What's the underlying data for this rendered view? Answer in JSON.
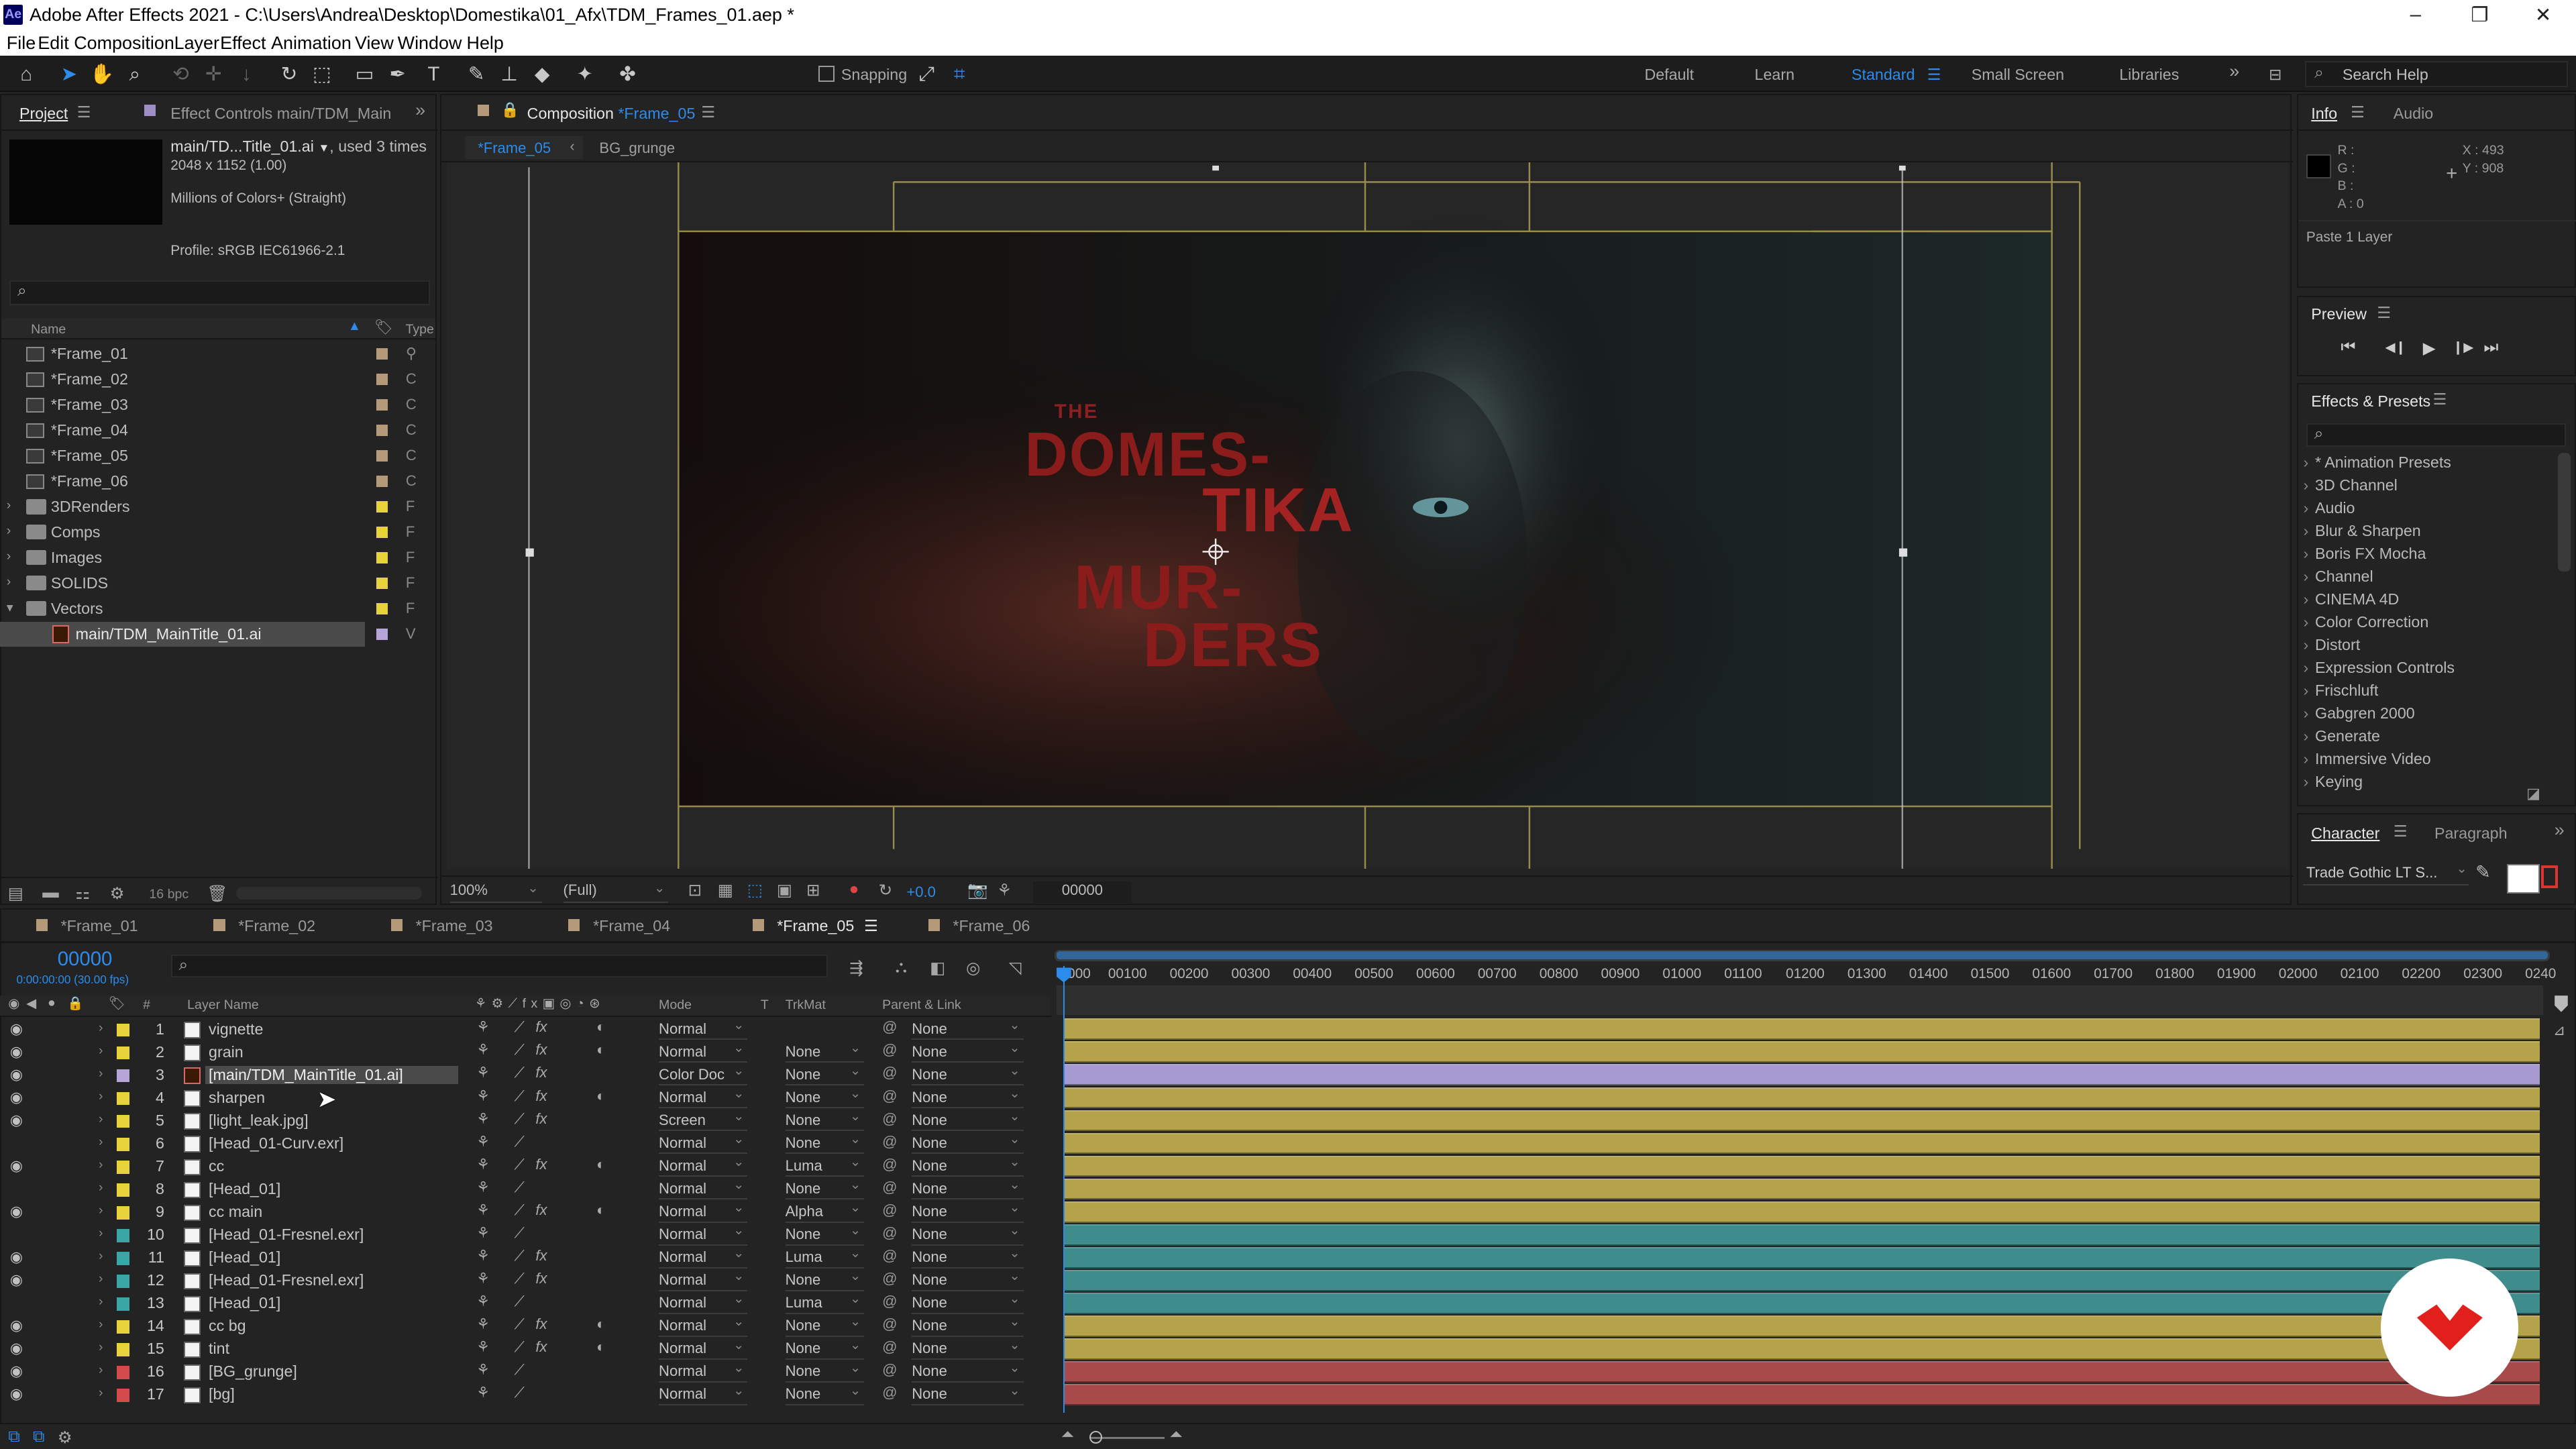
{
  "app": {
    "title": "Adobe After Effects 2021 - C:\\Users\\Andrea\\Desktop\\Domestika\\01_Afx\\TDM_Frames_01.aep *",
    "logo": "Ae",
    "window_controls": [
      "–",
      "❐",
      "✕"
    ]
  },
  "menu": [
    "File",
    "Edit",
    "Composition",
    "Layer",
    "Effect",
    "Animation",
    "View",
    "Window",
    "Help"
  ],
  "toolbar": {
    "snapping_label": "Snapping",
    "workspaces": [
      "Default",
      "Learn",
      "Standard",
      "Small Screen",
      "Libraries"
    ],
    "active_workspace": "Standard",
    "more": "»",
    "search_placeholder": "Search Help"
  },
  "project_panel": {
    "tab_project": "Project",
    "tab_effect_controls": "Effect Controls main/TDM_Main",
    "more": "»",
    "selected_name": "main/TD...Title_01.ai",
    "used_times": ", used 3 times",
    "dimensions": "2048 x 1152 (1.00)",
    "colors": "Millions of Colors+ (Straight)",
    "profile": "Profile: sRGB IEC61966-2.1",
    "search_icon": "⌕",
    "col_name": "Name",
    "col_type": "Type",
    "items": [
      {
        "name": "*Frame_01",
        "kind": "comp",
        "color": "#b59a7a",
        "type": "⚲"
      },
      {
        "name": "*Frame_02",
        "kind": "comp",
        "color": "#b59a7a",
        "type": "C"
      },
      {
        "name": "*Frame_03",
        "kind": "comp",
        "color": "#b59a7a",
        "type": "C"
      },
      {
        "name": "*Frame_04",
        "kind": "comp",
        "color": "#b59a7a",
        "type": "C"
      },
      {
        "name": "*Frame_05",
        "kind": "comp",
        "color": "#b59a7a",
        "type": "C"
      },
      {
        "name": "*Frame_06",
        "kind": "comp",
        "color": "#b59a7a",
        "type": "C"
      },
      {
        "name": "3DRenders",
        "kind": "folder",
        "color": "#e8d23a",
        "type": "F"
      },
      {
        "name": "Comps",
        "kind": "folder",
        "color": "#e8d23a",
        "type": "F"
      },
      {
        "name": "Images",
        "kind": "folder",
        "color": "#e8d23a",
        "type": "F"
      },
      {
        "name": "SOLIDS",
        "kind": "folder",
        "color": "#e8d23a",
        "type": "F"
      },
      {
        "name": "Vectors",
        "kind": "folder",
        "color": "#e8d23a",
        "type": "F"
      },
      {
        "name": "main/TDM_MainTitle_01.ai",
        "kind": "ai",
        "color": "#b6a5d8",
        "type": "V"
      }
    ],
    "bpc": "16 bpc"
  },
  "composition_panel": {
    "tab_label": "Composition",
    "tab_name": "*Frame_05",
    "sub_tab_active": "*Frame_05",
    "sub_tab_other": "BG_grunge",
    "title_lines": [
      "THE",
      "DOMES-",
      "TIKA",
      "MUR-",
      "DERS"
    ],
    "zoom": "100%",
    "resolution": "(Full)",
    "exposure": "+0.0",
    "timecode": "00000"
  },
  "info_panel": {
    "tab_info": "Info",
    "tab_audio": "Audio",
    "r": "R :",
    "g": "G :",
    "b": "B :",
    "a": "A : 0",
    "x": "X : 493",
    "y": "Y : 908",
    "message": "Paste 1 Layer"
  },
  "preview_panel": {
    "title": "Preview",
    "controls": [
      "⏮",
      "◀❙",
      "▶",
      "❙▶",
      "⏭"
    ]
  },
  "effects_panel": {
    "title": "Effects & Presets",
    "search_icon": "⌕",
    "categories": [
      "* Animation Presets",
      "3D Channel",
      "Audio",
      "Blur & Sharpen",
      "Boris FX Mocha",
      "Channel",
      "CINEMA 4D",
      "Color Correction",
      "Distort",
      "Expression Controls",
      "Frischluft",
      "Gabgren 2000",
      "Generate",
      "Immersive Video",
      "Keying"
    ]
  },
  "character_panel": {
    "tab_character": "Character",
    "tab_paragraph": "Paragraph",
    "font": "Trade Gothic LT S..."
  },
  "timeline": {
    "tabs": [
      {
        "name": "*Frame_01",
        "color": "#b59a7a"
      },
      {
        "name": "*Frame_02",
        "color": "#b59a7a"
      },
      {
        "name": "*Frame_03",
        "color": "#b59a7a"
      },
      {
        "name": "*Frame_04",
        "color": "#b59a7a"
      },
      {
        "name": "*Frame_05",
        "color": "#b59a7a"
      },
      {
        "name": "*Frame_06",
        "color": "#b59a7a"
      }
    ],
    "active_tab": "*Frame_05",
    "timecode": "00000",
    "fps": "0:00:00:00 (30.00 fps)",
    "search_icon": "⌕",
    "col_num": "#",
    "col_layer_name": "Layer Name",
    "col_mode": "Mode",
    "col_t": "T",
    "col_trkmat": "TrkMat",
    "col_parent": "Parent & Link",
    "ruler": [
      "0000",
      "00100",
      "00200",
      "00300",
      "00400",
      "00500",
      "00600",
      "00700",
      "00800",
      "00900",
      "01000",
      "01100",
      "01200",
      "01300",
      "01400",
      "01500",
      "01600",
      "01700",
      "01800",
      "01900",
      "02000",
      "02100",
      "02200",
      "02300",
      "0240"
    ],
    "layers": [
      {
        "num": "1",
        "name": "vignette",
        "label": "#e8d23a",
        "eye": true,
        "fx": true,
        "adj": true,
        "mode": "Normal",
        "trkmat": "",
        "parent": "None",
        "bar": "#b4a34a"
      },
      {
        "num": "2",
        "name": "grain",
        "label": "#e8d23a",
        "eye": true,
        "fx": true,
        "adj": true,
        "mode": "Normal",
        "trkmat": "None",
        "parent": "None",
        "bar": "#b4a34a"
      },
      {
        "num": "3",
        "name": "[main/TDM_MainTitle_01.ai]",
        "label": "#b6a5d8",
        "eye": true,
        "fx": true,
        "adj": false,
        "mode": "Color Doc",
        "trkmat": "None",
        "parent": "None",
        "bar": "#9c90c4",
        "selected": true
      },
      {
        "num": "4",
        "name": "sharpen",
        "label": "#e8d23a",
        "eye": true,
        "fx": true,
        "adj": true,
        "mode": "Normal",
        "trkmat": "None",
        "parent": "None",
        "bar": "#b4a34a"
      },
      {
        "num": "5",
        "name": "[light_leak.jpg]",
        "label": "#e8d23a",
        "eye": true,
        "fx": true,
        "adj": false,
        "mode": "Screen",
        "trkmat": "None",
        "parent": "None",
        "bar": "#b4a34a"
      },
      {
        "num": "6",
        "name": "[Head_01-Curv.exr]",
        "label": "#e8d23a",
        "eye": false,
        "fx": false,
        "adj": false,
        "mode": "Normal",
        "trkmat": "None",
        "parent": "None",
        "bar": "#b4a34a"
      },
      {
        "num": "7",
        "name": "cc",
        "label": "#e8d23a",
        "eye": true,
        "fx": true,
        "adj": true,
        "mode": "Normal",
        "trkmat": "Luma",
        "parent": "None",
        "bar": "#b4a34a"
      },
      {
        "num": "8",
        "name": "[Head_01]",
        "label": "#e8d23a",
        "eye": false,
        "fx": false,
        "adj": false,
        "mode": "Normal",
        "trkmat": "None",
        "parent": "None",
        "bar": "#b4a34a"
      },
      {
        "num": "9",
        "name": "cc main",
        "label": "#e8d23a",
        "eye": true,
        "fx": true,
        "adj": true,
        "mode": "Normal",
        "trkmat": "Alpha",
        "parent": "None",
        "bar": "#b4a34a"
      },
      {
        "num": "10",
        "name": "[Head_01-Fresnel.exr]",
        "label": "#3aa6a6",
        "eye": false,
        "fx": false,
        "adj": false,
        "mode": "Normal",
        "trkmat": "None",
        "parent": "None",
        "bar": "#3f8c8c"
      },
      {
        "num": "11",
        "name": "[Head_01]",
        "label": "#3aa6a6",
        "eye": true,
        "fx": true,
        "adj": false,
        "mode": "Normal",
        "trkmat": "Luma",
        "parent": "None",
        "bar": "#3f8c8c"
      },
      {
        "num": "12",
        "name": "[Head_01-Fresnel.exr]",
        "label": "#3aa6a6",
        "eye": true,
        "fx": true,
        "adj": false,
        "mode": "Normal",
        "trkmat": "None",
        "parent": "None",
        "bar": "#3f8c8c"
      },
      {
        "num": "13",
        "name": "[Head_01]",
        "label": "#3aa6a6",
        "eye": false,
        "fx": false,
        "adj": false,
        "mode": "Normal",
        "trkmat": "Luma",
        "parent": "None",
        "bar": "#3f8c8c"
      },
      {
        "num": "14",
        "name": "cc bg",
        "label": "#e8d23a",
        "eye": true,
        "fx": true,
        "adj": true,
        "mode": "Normal",
        "trkmat": "None",
        "parent": "None",
        "bar": "#b4a34a"
      },
      {
        "num": "15",
        "name": "tint",
        "label": "#e8d23a",
        "eye": true,
        "fx": true,
        "adj": true,
        "mode": "Normal",
        "trkmat": "None",
        "parent": "None",
        "bar": "#b4a34a"
      },
      {
        "num": "16",
        "name": "[BG_grunge]",
        "label": "#d24a4a",
        "eye": true,
        "fx": false,
        "adj": false,
        "mode": "Normal",
        "trkmat": "None",
        "parent": "None",
        "bar": "#a84a4a"
      },
      {
        "num": "17",
        "name": "[bg]",
        "label": "#d24a4a",
        "eye": true,
        "fx": false,
        "adj": false,
        "mode": "Normal",
        "trkmat": "None",
        "parent": "None",
        "bar": "#a84a4a"
      }
    ]
  },
  "colors": {
    "accent_blue": "#2d8ceb",
    "title_red": "#a01f1f",
    "guide_yellow": "#bfae5a"
  }
}
